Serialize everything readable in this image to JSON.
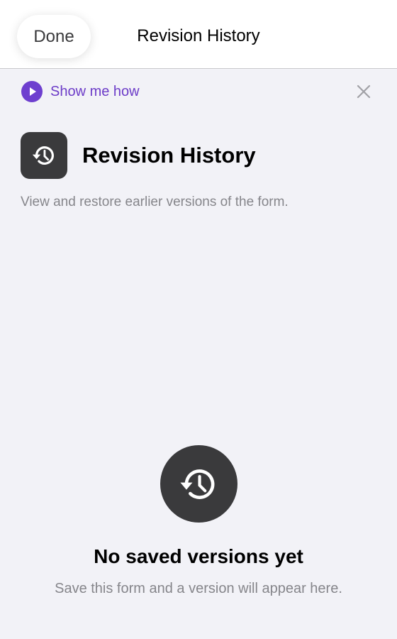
{
  "nav": {
    "done_label": "Done",
    "title": "Revision History"
  },
  "tip": {
    "show_me_how_label": "Show me how",
    "accent_color": "#6e3fcf",
    "icons": [
      "play-icon",
      "close-icon"
    ]
  },
  "feature": {
    "title": "Revision History",
    "description": "View and restore earlier versions of the form.",
    "icon": "history-icon"
  },
  "empty_state": {
    "title": "No saved versions yet",
    "subtitle": "Save this form and a version will appear here.",
    "icon": "history-icon"
  }
}
